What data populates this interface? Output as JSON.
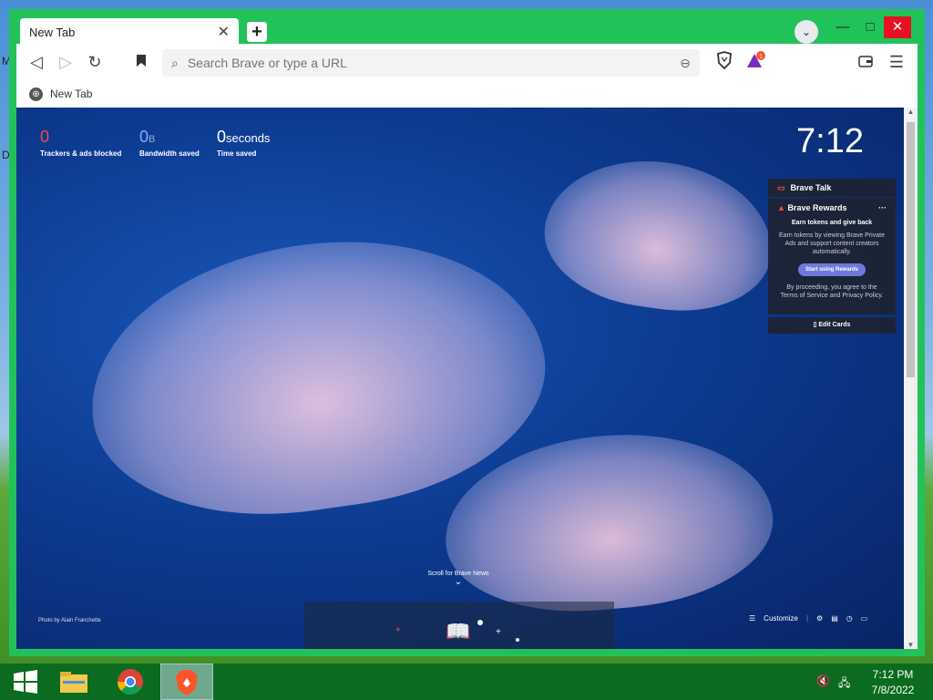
{
  "desktop": {
    "labels": [
      "M",
      "D"
    ]
  },
  "tab": {
    "title": "New Tab",
    "close": "✕"
  },
  "toolbar": {
    "placeholder": "Search Brave or type a URL",
    "rewards_badge": "1"
  },
  "window": {
    "minimize": "—",
    "maximize": "□",
    "close": "✕"
  },
  "bookmarks": {
    "item": "New Tab"
  },
  "stats": [
    {
      "value": "0",
      "unit": "",
      "label": "Trackers & ads blocked",
      "color": "#e6533c"
    },
    {
      "value": "0",
      "unit": "B",
      "label": "Bandwidth saved",
      "color": "#8ca8ff"
    },
    {
      "value": "0",
      "unit": "seconds",
      "label": "Time saved",
      "color": "#ffffff"
    }
  ],
  "clock": "7:12",
  "cards": {
    "talk": "Brave Talk",
    "rewards_title": "Brave Rewards",
    "rewards_menu": "···",
    "rewards_sub": "Earn tokens and give back",
    "rewards_desc": "Earn tokens by viewing Brave Private Ads and support content creators automatically.",
    "rewards_button": "Start using Rewards",
    "rewards_terms": "By proceeding, you agree to the Terms of Service and Privacy Policy.",
    "edit": "Edit Cards"
  },
  "scroll_news": "Scroll for Brave News",
  "photo_credit": "Photo by Alain Franchette",
  "customize": "Customize",
  "taskbar": {
    "time": "7:12 PM",
    "date": "7/8/2022"
  },
  "colors": {
    "window_border": "#22c25a",
    "brave_orange": "#fb542b",
    "page_bg": "#0d3b91"
  }
}
